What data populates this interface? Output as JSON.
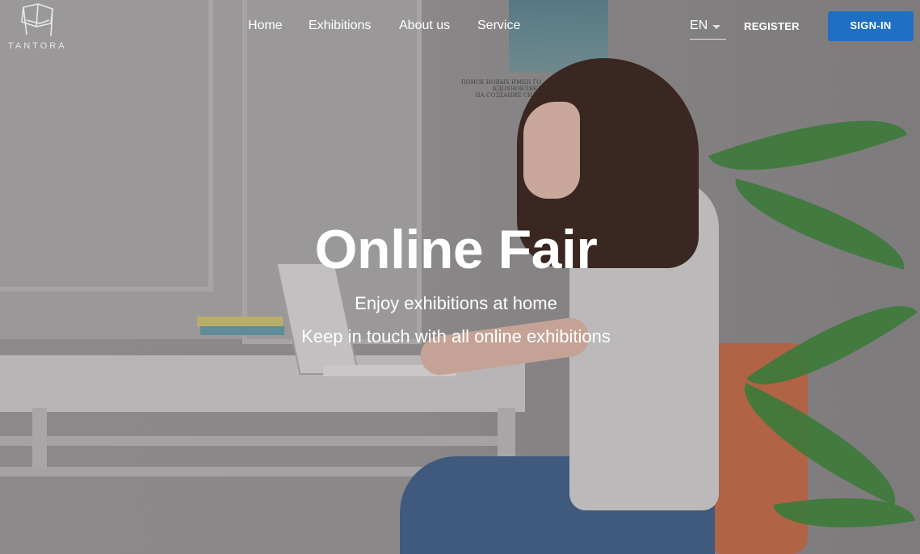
{
  "brand": {
    "name": "TANTORA",
    "logo_icon": "chair-outline-icon"
  },
  "nav": {
    "links": [
      "Home",
      "Exhibitions",
      "About us",
      "Service"
    ],
    "language": "EN",
    "register_label": "REGISTER",
    "signin_label": "SIGN-IN"
  },
  "hero": {
    "title": "Online Fair",
    "subtitle_1": "Enjoy exhibitions at home",
    "subtitle_2": "Keep in touch with all online exhibitions",
    "poster_text": "ПОИСК НОВЫХ ИМЕН ГО\nКДОХНОВЛЯЕТ\nНА СОЗДАНИЕ СИЛЬ"
  },
  "colors": {
    "signin_bg": "#1f6fc5",
    "text": "#ffffff"
  }
}
